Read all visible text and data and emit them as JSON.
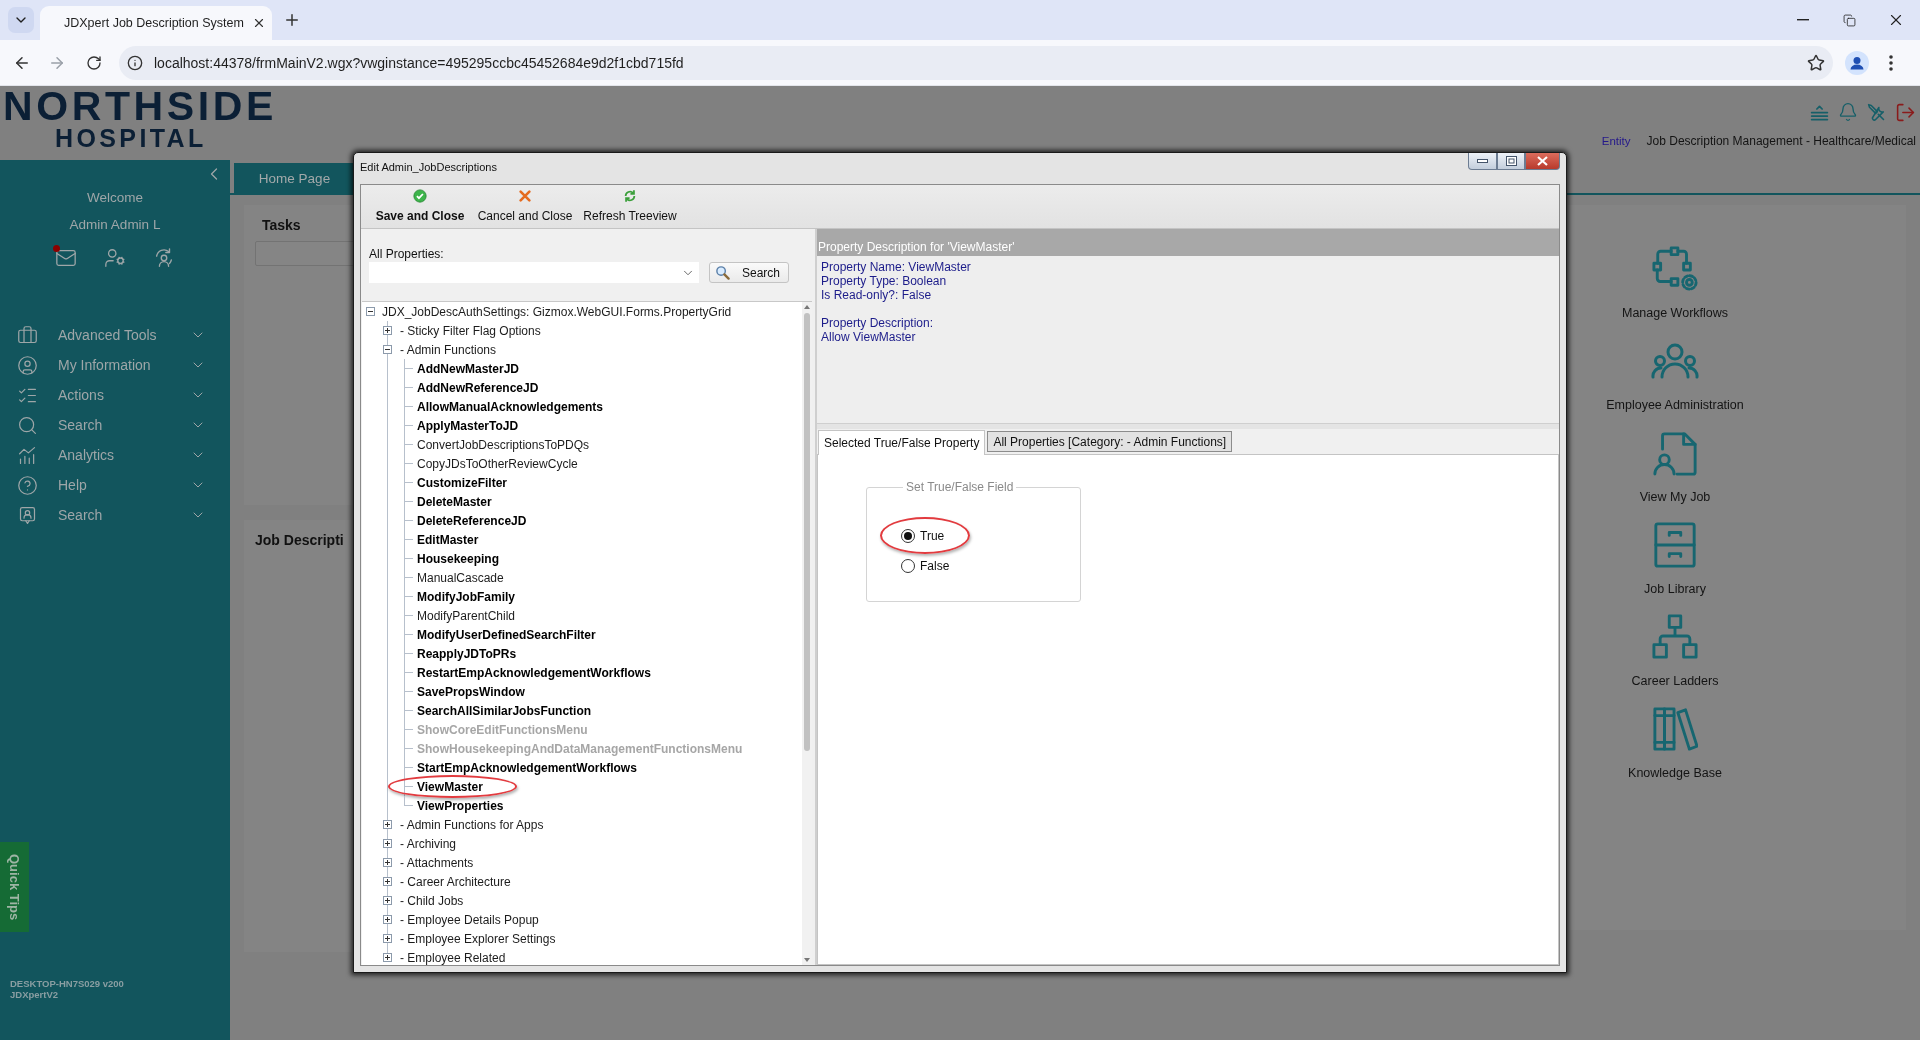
{
  "browser": {
    "tab_title": "JDXpert Job Description System",
    "address": "localhost:44378/frmMainV2.wgx?vwginstance=495295ccbc45452684e9d2f1cbd715fd"
  },
  "header": {
    "logo": [
      "NORTHSIDE",
      "HOSPITAL"
    ],
    "entity": "Entity",
    "module": "Job Description Management - Healthcare/Medical"
  },
  "sidebar": {
    "welcome": "Welcome",
    "user": "Admin Admin L",
    "mail_unread": true,
    "items": [
      {
        "label": "Advanced Tools",
        "expanded": false
      },
      {
        "label": "My Information",
        "expanded": false
      },
      {
        "label": "Actions",
        "expanded": false
      },
      {
        "label": "Search",
        "expanded": false
      },
      {
        "label": "Analytics",
        "expanded": false
      },
      {
        "label": "Help",
        "expanded": false
      },
      {
        "label": "Search",
        "expanded": false
      }
    ],
    "quick_tips": "Quick Tips",
    "footer": [
      "DESKTOP-HN7S029 v200",
      "JDXpertV2"
    ]
  },
  "tabs": [
    {
      "label": "Home Page",
      "selected": true
    }
  ],
  "panels": [
    {
      "title": "Tasks",
      "kind": "filtered"
    },
    {
      "title": "Job Descripti",
      "kind": "plain"
    }
  ],
  "shortcuts": [
    "Manage Workflows",
    "Employee Administration",
    "View My Job",
    "Job Library",
    "Career Ladders",
    "Knowledge Base"
  ],
  "dialog": {
    "title": "Edit Admin_JobDescriptions",
    "toolbar": [
      {
        "label": "Save and Close",
        "kind": "save",
        "default": true
      },
      {
        "label": "Cancel and Close",
        "kind": "cancel",
        "default": false
      },
      {
        "label": "Refresh Treeview",
        "kind": "refresh",
        "default": false
      }
    ],
    "filter": {
      "label": "All Properties:",
      "button": "Search"
    },
    "tree": {
      "label": "JDX_JobDescAuthSettings: Gizmox.WebGUI.Forms.PropertyGrid",
      "kind": "group",
      "expanded": true,
      "children": [
        {
          "label": "- Sticky Filter Flag Options",
          "kind": "group",
          "expanded": false
        },
        {
          "label": "- Admin Functions",
          "kind": "group",
          "expanded": true,
          "children": [
            {
              "label": "AddNewMasterJD",
              "kind": "property",
              "bold": true,
              "disabled": false,
              "circled": false
            },
            {
              "label": "AddNewReferenceJD",
              "kind": "property",
              "bold": true,
              "disabled": false,
              "circled": false
            },
            {
              "label": "AllowManualAcknowledgements",
              "kind": "property",
              "bold": true,
              "disabled": false,
              "circled": false
            },
            {
              "label": "ApplyMasterToJD",
              "kind": "property",
              "bold": true,
              "disabled": false,
              "circled": false
            },
            {
              "label": "ConvertJobDescriptionsToPDQs",
              "kind": "property",
              "bold": false,
              "disabled": false,
              "circled": false
            },
            {
              "label": "CopyJDsToOtherReviewCycle",
              "kind": "property",
              "bold": false,
              "disabled": false,
              "circled": false
            },
            {
              "label": "CustomizeFilter",
              "kind": "property",
              "bold": true,
              "disabled": false,
              "circled": false
            },
            {
              "label": "DeleteMaster",
              "kind": "property",
              "bold": true,
              "disabled": false,
              "circled": false
            },
            {
              "label": "DeleteReferenceJD",
              "kind": "property",
              "bold": true,
              "disabled": false,
              "circled": false
            },
            {
              "label": "EditMaster",
              "kind": "property",
              "bold": true,
              "disabled": false,
              "circled": false
            },
            {
              "label": "Housekeeping",
              "kind": "property",
              "bold": true,
              "disabled": false,
              "circled": false
            },
            {
              "label": "ManualCascade",
              "kind": "property",
              "bold": false,
              "disabled": false,
              "circled": false
            },
            {
              "label": "ModifyJobFamily",
              "kind": "property",
              "bold": true,
              "disabled": false,
              "circled": false
            },
            {
              "label": "ModifyParentChild",
              "kind": "property",
              "bold": false,
              "disabled": false,
              "circled": false
            },
            {
              "label": "ModifyUserDefinedSearchFilter",
              "kind": "property",
              "bold": true,
              "disabled": false,
              "circled": false
            },
            {
              "label": "ReapplyJDToPRs",
              "kind": "property",
              "bold": true,
              "disabled": false,
              "circled": false
            },
            {
              "label": "RestartEmpAcknowledgementWorkflows",
              "kind": "property",
              "bold": true,
              "disabled": false,
              "circled": false
            },
            {
              "label": "SavePropsWindow",
              "kind": "property",
              "bold": true,
              "disabled": false,
              "circled": false
            },
            {
              "label": "SearchAllSimilarJobsFunction",
              "kind": "property",
              "bold": true,
              "disabled": false,
              "circled": false
            },
            {
              "label": "ShowCoreEditFunctionsMenu",
              "kind": "property",
              "bold": true,
              "disabled": true,
              "circled": false
            },
            {
              "label": "ShowHousekeepingAndDataManagementFunctionsMenu",
              "kind": "property",
              "bold": true,
              "disabled": true,
              "circled": false
            },
            {
              "label": "StartEmpAcknowledgementWorkflows",
              "kind": "property",
              "bold": true,
              "disabled": false,
              "circled": false
            },
            {
              "label": "ViewMaster",
              "kind": "property",
              "bold": true,
              "disabled": false,
              "circled": true
            },
            {
              "label": "ViewProperties",
              "kind": "property",
              "bold": true,
              "disabled": false,
              "circled": false
            }
          ]
        },
        {
          "label": "- Admin Functions for Apps",
          "kind": "group",
          "expanded": false
        },
        {
          "label": "- Archiving",
          "kind": "group",
          "expanded": false
        },
        {
          "label": "- Attachments",
          "kind": "group",
          "expanded": false
        },
        {
          "label": "- Career Architecture",
          "kind": "group",
          "expanded": false
        },
        {
          "label": "- Child Jobs",
          "kind": "group",
          "expanded": false
        },
        {
          "label": "- Employee Details Popup",
          "kind": "group",
          "expanded": false
        },
        {
          "label": "- Employee Explorer Settings",
          "kind": "group",
          "expanded": false
        },
        {
          "label": "- Employee Related",
          "kind": "group",
          "expanded": false
        }
      ]
    },
    "description": {
      "heading": "Property Description for 'ViewMaster'",
      "blocks": [
        [
          "Property Name: ViewMaster",
          "Property Type: Boolean",
          "Is Read-only?: False"
        ],
        [
          "Property Description:",
          "Allow ViewMaster"
        ]
      ]
    },
    "tabs": [
      {
        "label": "Selected True/False Property",
        "selected": true
      },
      {
        "label": "All Properties [Category: - Admin Functions]",
        "selected": false
      }
    ],
    "group": {
      "legend": "Set True/False Field",
      "options": [
        {
          "label": "True",
          "selected": true,
          "circled": true
        },
        {
          "label": "False",
          "selected": false,
          "circled": false
        }
      ]
    }
  }
}
